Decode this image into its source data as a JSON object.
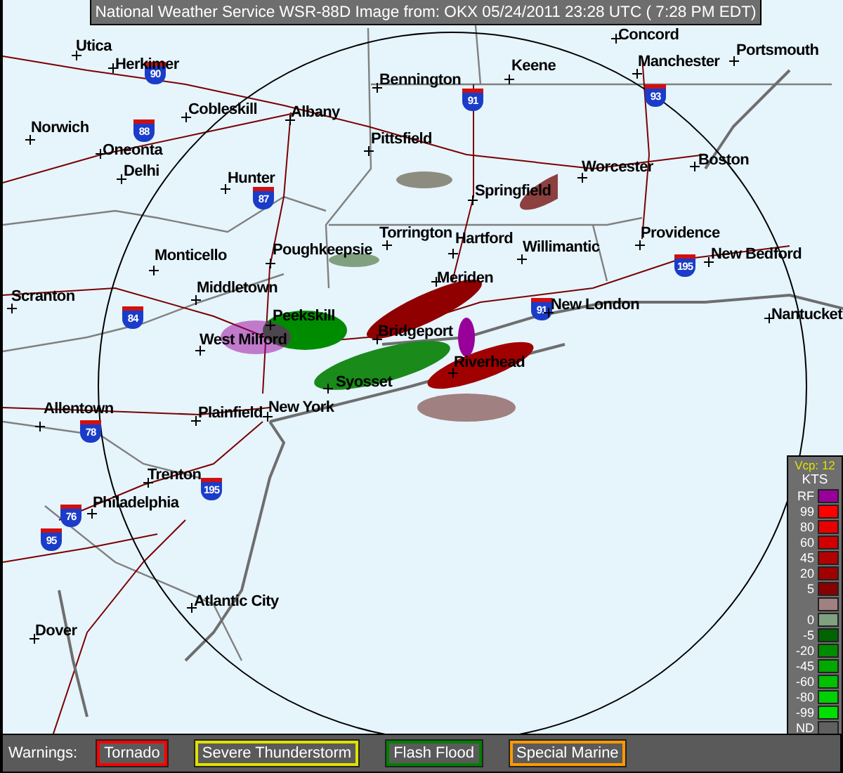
{
  "title_bar": {
    "text": "National Weather Service WSR-88D Image from: OKX 05/24/2011 23:28 UTC ( 7:28 PM EDT)"
  },
  "cities": [
    {
      "name": "Utica"
    },
    {
      "name": "Concord"
    },
    {
      "name": "Portsmouth"
    },
    {
      "name": "Herkimer"
    },
    {
      "name": "Keene"
    },
    {
      "name": "Manchester"
    },
    {
      "name": "Bennington"
    },
    {
      "name": "Cobleskill"
    },
    {
      "name": "Albany"
    },
    {
      "name": "Norwich"
    },
    {
      "name": "Oneonta"
    },
    {
      "name": "Pittsfield"
    },
    {
      "name": "Delhi"
    },
    {
      "name": "Worcester"
    },
    {
      "name": "Boston"
    },
    {
      "name": "Hunter"
    },
    {
      "name": "Springfield"
    },
    {
      "name": "Torrington"
    },
    {
      "name": "Hartford"
    },
    {
      "name": "Willimantic"
    },
    {
      "name": "Providence"
    },
    {
      "name": "Monticello"
    },
    {
      "name": "Poughkeepsie"
    },
    {
      "name": "New Bedford"
    },
    {
      "name": "Meriden"
    },
    {
      "name": "Middletown"
    },
    {
      "name": "Scranton"
    },
    {
      "name": "New London"
    },
    {
      "name": "Nantucket"
    },
    {
      "name": "Peekskill"
    },
    {
      "name": "Bridgeport"
    },
    {
      "name": "West Milford"
    },
    {
      "name": "Riverhead"
    },
    {
      "name": "Syosset"
    },
    {
      "name": "Allentown"
    },
    {
      "name": "Plainfield"
    },
    {
      "name": "New York"
    },
    {
      "name": "Trenton"
    },
    {
      "name": "Philadelphia"
    },
    {
      "name": "Atlantic City"
    },
    {
      "name": "Dover"
    }
  ],
  "interstates": [
    {
      "number": "90"
    },
    {
      "number": "91"
    },
    {
      "number": "93"
    },
    {
      "number": "88"
    },
    {
      "number": "87"
    },
    {
      "number": "195"
    },
    {
      "number": "84"
    },
    {
      "number": "91"
    },
    {
      "number": "78"
    },
    {
      "number": "195"
    },
    {
      "number": "76"
    },
    {
      "number": "95"
    }
  ],
  "legend": {
    "mode": "Vcp: 12",
    "unit": "KTS",
    "bins": [
      {
        "label": "RF",
        "color": "#990099"
      },
      {
        "label": "99",
        "color": "#ff0000"
      },
      {
        "label": "80",
        "color": "#e80000"
      },
      {
        "label": "60",
        "color": "#d00000"
      },
      {
        "label": "45",
        "color": "#b40000"
      },
      {
        "label": "20",
        "color": "#a00000"
      },
      {
        "label": "5",
        "color": "#880000"
      },
      {
        "color": "#a08080"
      },
      {
        "label": "0",
        "color": "#80a080"
      },
      {
        "label": "-5",
        "color": "#006400"
      },
      {
        "label": "-20",
        "color": "#008c00"
      },
      {
        "label": "-45",
        "color": "#00a800"
      },
      {
        "label": "-60",
        "color": "#00c000"
      },
      {
        "label": "-80",
        "color": "#00d000"
      },
      {
        "label": "-99",
        "color": "#00e000"
      },
      {
        "label": "ND",
        "color": "#606060"
      }
    ]
  },
  "warnings": {
    "label": "Warnings:",
    "items": [
      {
        "label": "Tornado",
        "color": "#ff0000"
      },
      {
        "label": "Severe Thunderstorm",
        "color": "#e0e000"
      },
      {
        "label": "Flash Flood",
        "color": "#008000"
      },
      {
        "label": "Special Marine",
        "color": "#ff9900"
      }
    ]
  }
}
